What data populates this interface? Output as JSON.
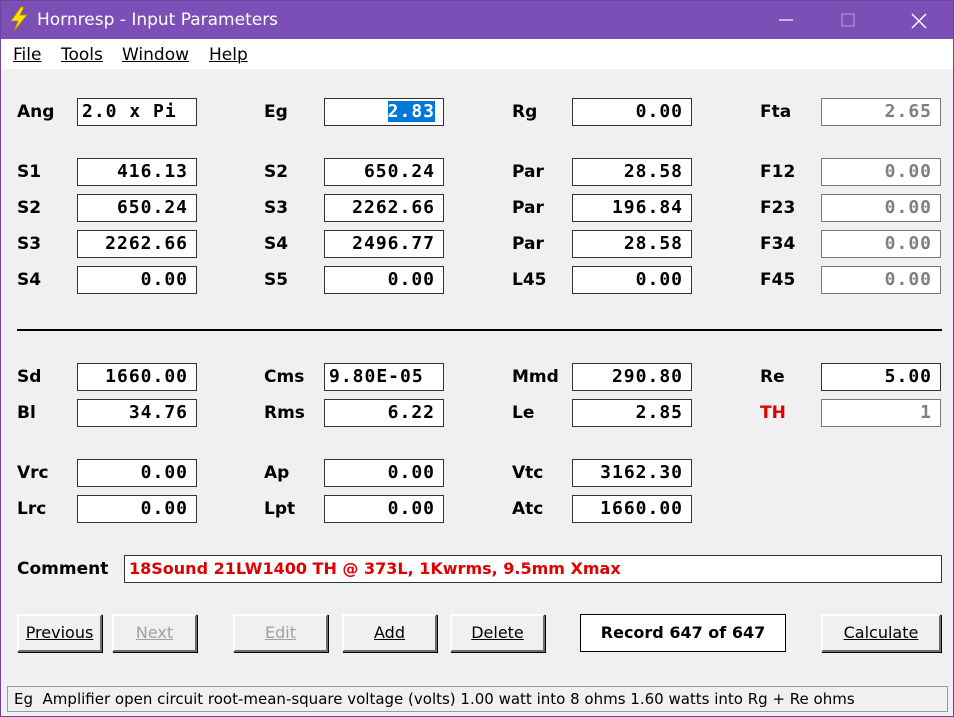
{
  "window": {
    "title": "Hornresp - Input Parameters"
  },
  "menu": [
    "File",
    "Tools",
    "Window",
    "Help"
  ],
  "rows": {
    "r1": [
      {
        "label": "Ang",
        "value": "2.0 x Pi"
      },
      {
        "label": "Eg",
        "value": "2.83"
      },
      {
        "label": "Rg",
        "value": "0.00"
      },
      {
        "label": "Fta",
        "value": "2.65"
      }
    ],
    "r2": [
      {
        "label": "S1",
        "value": "416.13"
      },
      {
        "label": "S2",
        "value": "650.24"
      },
      {
        "label": "Par",
        "value": "28.58"
      },
      {
        "label": "F12",
        "value": "0.00"
      }
    ],
    "r3": [
      {
        "label": "S2",
        "value": "650.24"
      },
      {
        "label": "S3",
        "value": "2262.66"
      },
      {
        "label": "Par",
        "value": "196.84"
      },
      {
        "label": "F23",
        "value": "0.00"
      }
    ],
    "r4": [
      {
        "label": "S3",
        "value": "2262.66"
      },
      {
        "label": "S4",
        "value": "2496.77"
      },
      {
        "label": "Par",
        "value": "28.58"
      },
      {
        "label": "F34",
        "value": "0.00"
      }
    ],
    "r5": [
      {
        "label": "S4",
        "value": "0.00"
      },
      {
        "label": "S5",
        "value": "0.00"
      },
      {
        "label": "L45",
        "value": "0.00"
      },
      {
        "label": "F45",
        "value": "0.00"
      }
    ],
    "r6": [
      {
        "label": "Sd",
        "value": "1660.00"
      },
      {
        "label": "Cms",
        "value": "9.80E-05"
      },
      {
        "label": "Mmd",
        "value": "290.80"
      },
      {
        "label": "Re",
        "value": "5.00"
      }
    ],
    "r7": [
      {
        "label": "Bl",
        "value": "34.76"
      },
      {
        "label": "Rms",
        "value": "6.22"
      },
      {
        "label": "Le",
        "value": "2.85"
      },
      {
        "label": "TH",
        "value": "1"
      }
    ],
    "r8": [
      {
        "label": "Vrc",
        "value": "0.00"
      },
      {
        "label": "Ap",
        "value": "0.00"
      },
      {
        "label": "Vtc",
        "value": "3162.30"
      }
    ],
    "r9": [
      {
        "label": "Lrc",
        "value": "0.00"
      },
      {
        "label": "Lpt",
        "value": "0.00"
      },
      {
        "label": "Atc",
        "value": "1660.00"
      }
    ]
  },
  "comment": {
    "label": "Comment",
    "value": "18Sound 21LW1400 TH @ 373L, 1Kwrms, 9.5mm Xmax"
  },
  "buttons": {
    "previous": "Previous",
    "next": "Next",
    "edit": "Edit",
    "add": "Add",
    "delete": "Delete",
    "calculate": "Calculate"
  },
  "record": "Record 647 of 647",
  "status": {
    "code": "Eg",
    "text": "Amplifier open circuit root-mean-square voltage  (volts)  1.00 watt into 8 ohms   1.60 watts into Rg + Re ohms"
  },
  "colors": {
    "titlebar": "#7b4fb6",
    "accent_red": "#e00000",
    "selection": "#0078d7"
  }
}
